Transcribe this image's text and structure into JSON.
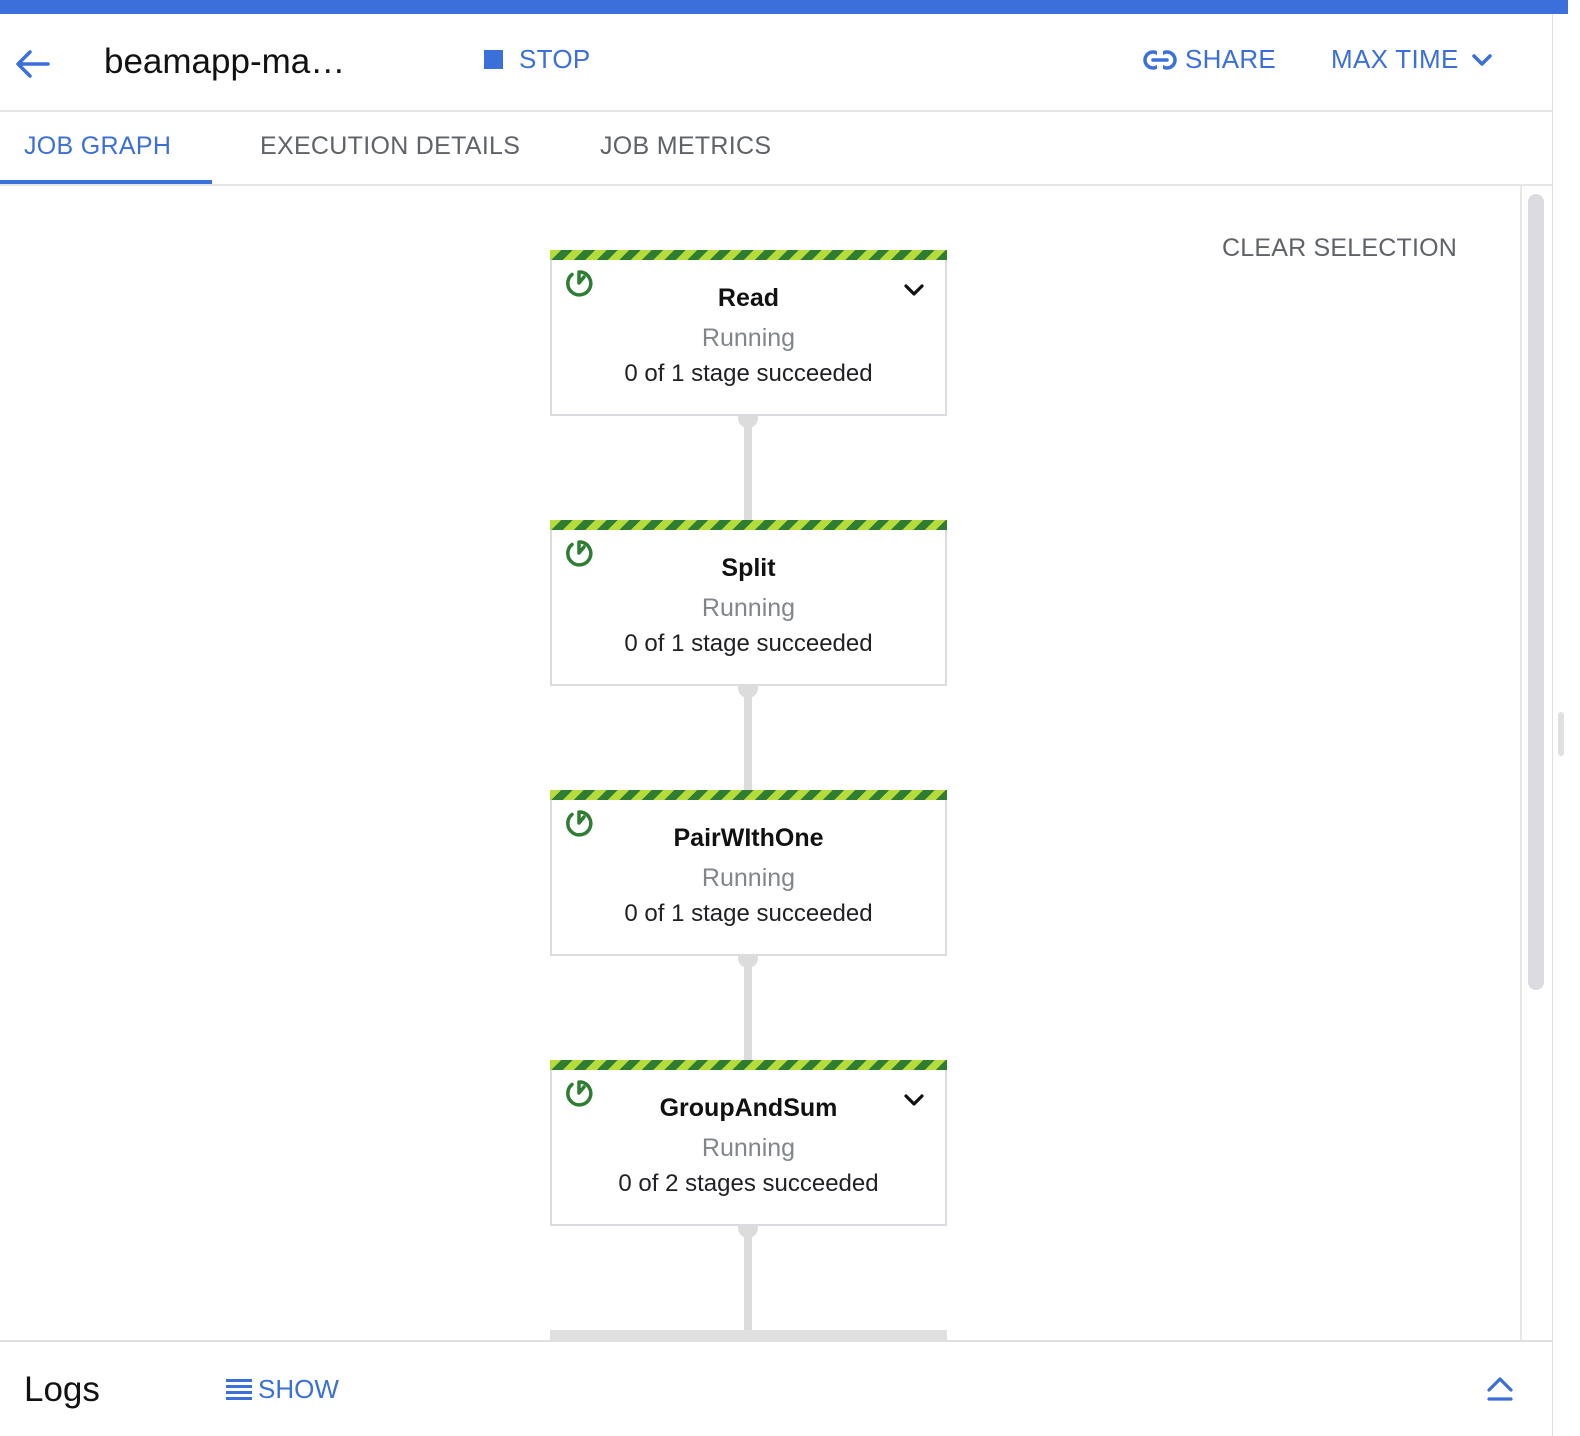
{
  "header": {
    "job_title": "beamapp-ma…",
    "stop_label": "STOP",
    "share_label": "SHARE",
    "max_time_label": "MAX TIME"
  },
  "tabs": [
    {
      "label": "JOB GRAPH",
      "active": true
    },
    {
      "label": "EXECUTION DETAILS",
      "active": false
    },
    {
      "label": "JOB METRICS",
      "active": false
    }
  ],
  "graph": {
    "clear_selection_label": "CLEAR SELECTION",
    "nodes": [
      {
        "name": "Read",
        "status": "Running",
        "progress": "0 of 1 stage succeeded",
        "expandable": true,
        "icon": "running-icon"
      },
      {
        "name": "Split",
        "status": "Running",
        "progress": "0 of 1 stage succeeded",
        "expandable": false,
        "icon": "running-icon"
      },
      {
        "name": "PairWIthOne",
        "status": "Running",
        "progress": "0 of 1 stage succeeded",
        "expandable": false,
        "icon": "running-icon"
      },
      {
        "name": "GroupAndSum",
        "status": "Running",
        "progress": "0 of 2 stages succeeded",
        "expandable": true,
        "icon": "running-icon"
      }
    ]
  },
  "logs": {
    "title": "Logs",
    "show_label": "SHOW"
  },
  "colors": {
    "accent": "#3b6fd9",
    "running_green": "#2e7d32",
    "stripe_light": "#b5dc3a",
    "stripe_dark": "#2f7d32"
  }
}
